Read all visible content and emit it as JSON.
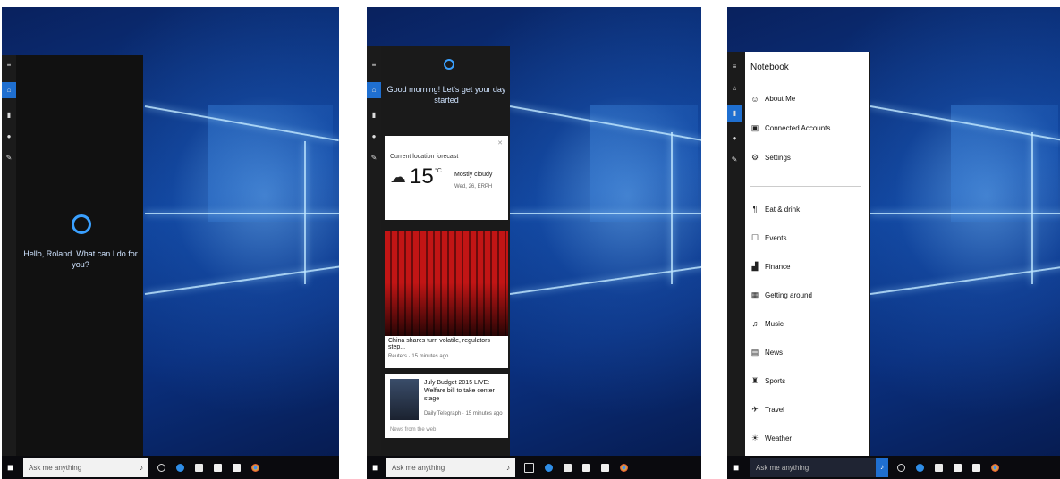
{
  "panel1": {
    "greeting": "Hello, Roland. What can I do for you?",
    "search_placeholder": "Ask me anything",
    "rail_icons": [
      "menu-icon",
      "home-icon",
      "notebook-icon",
      "location-icon",
      "feedback-icon"
    ]
  },
  "panel2": {
    "greeting": "Good morning! Let's get your day started",
    "weather": {
      "header": "Current location forecast",
      "temp": "15",
      "unit": "°C",
      "condition": "Mostly cloudy",
      "date": "Wed, 26, ERPH"
    },
    "news1": {
      "headline": "China shares turn volatile, regulators step...",
      "source": "Reuters · 15 minutes ago"
    },
    "news2": {
      "headline": "July Budget 2015 LIVE: Welfare bill to take center stage",
      "source": "Daily Telegraph · 15 minutes ago"
    },
    "footer_label": "News from the web",
    "search_placeholder": "Ask me anything"
  },
  "panel3": {
    "title": "Notebook",
    "top_items": [
      {
        "label": "About Me",
        "icon": "person-icon",
        "glyph": "☺"
      },
      {
        "label": "Connected Accounts",
        "icon": "accounts-icon",
        "glyph": "▣"
      },
      {
        "label": "Settings",
        "icon": "settings-icon",
        "glyph": "⚙"
      }
    ],
    "items": [
      {
        "label": "Eat & drink",
        "icon": "food-icon",
        "glyph": "¶"
      },
      {
        "label": "Events",
        "icon": "events-icon",
        "glyph": "☐"
      },
      {
        "label": "Finance",
        "icon": "finance-icon",
        "glyph": "▟"
      },
      {
        "label": "Getting around",
        "icon": "car-icon",
        "glyph": "▦"
      },
      {
        "label": "Music",
        "icon": "music-icon",
        "glyph": "♫"
      },
      {
        "label": "News",
        "icon": "news-icon",
        "glyph": "▤"
      },
      {
        "label": "Sports",
        "icon": "sports-icon",
        "glyph": "♜"
      },
      {
        "label": "Travel",
        "icon": "travel-icon",
        "glyph": "✈"
      },
      {
        "label": "Weather",
        "icon": "weather-icon",
        "glyph": "☀"
      }
    ],
    "search_placeholder": "Ask me anything"
  },
  "colors": {
    "accent": "#1f6fd0",
    "cortana": "#3aa0ff",
    "dark_panel": "#1b1b1b"
  }
}
